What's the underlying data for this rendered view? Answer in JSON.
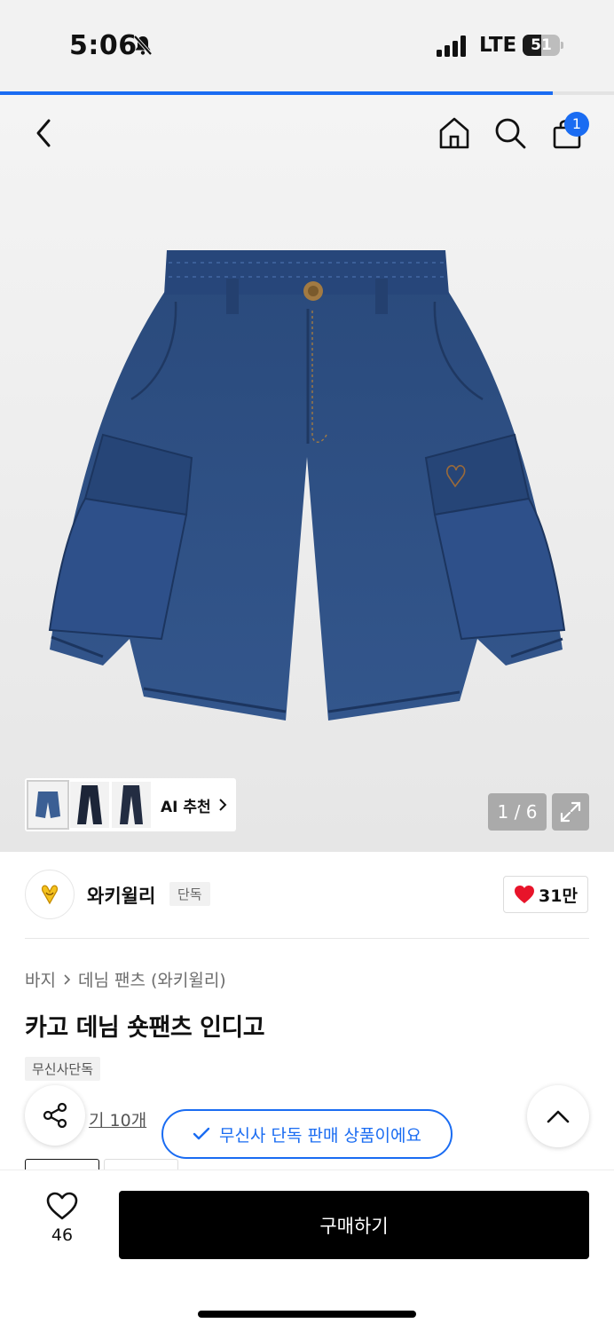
{
  "status": {
    "time": "5:06",
    "network": "LTE",
    "battery": "51",
    "battery_level": 0.51
  },
  "scroll_progress": 0.9,
  "nav": {
    "back_icon": "chevron-left-icon",
    "home_icon": "home-icon",
    "search_icon": "search-icon",
    "cart_icon": "shopping-bag-icon",
    "cart_badge": "1"
  },
  "gallery": {
    "counter": "1 / 6",
    "rec_label": "AI 추천",
    "expand_icon": "expand-icon"
  },
  "brand": {
    "name": "와키윌리",
    "tag": "단독",
    "likes": "31만"
  },
  "product": {
    "breadcrumb": [
      "바지",
      "데님 팬츠 (와키윌리)"
    ],
    "title": "카고 데님 숏팬츠 인디고",
    "tag": "무신사단독",
    "review_link": "기 10개"
  },
  "toast": "무신사 단독 판매 상품이에요",
  "bottom": {
    "wish_count": "46",
    "buy_label": "구매하기"
  },
  "colors": {
    "accent": "#1a6cf2",
    "like_red": "#e8142a",
    "denim": "#2d4f83"
  }
}
